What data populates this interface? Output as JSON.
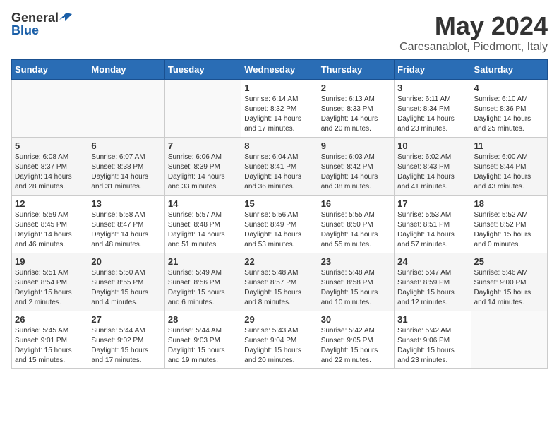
{
  "logo": {
    "general": "General",
    "blue": "Blue"
  },
  "title": "May 2024",
  "subtitle": "Caresanablot, Piedmont, Italy",
  "days_of_week": [
    "Sunday",
    "Monday",
    "Tuesday",
    "Wednesday",
    "Thursday",
    "Friday",
    "Saturday"
  ],
  "weeks": [
    [
      {
        "num": "",
        "info": ""
      },
      {
        "num": "",
        "info": ""
      },
      {
        "num": "",
        "info": ""
      },
      {
        "num": "1",
        "info": "Sunrise: 6:14 AM\nSunset: 8:32 PM\nDaylight: 14 hours\nand 17 minutes."
      },
      {
        "num": "2",
        "info": "Sunrise: 6:13 AM\nSunset: 8:33 PM\nDaylight: 14 hours\nand 20 minutes."
      },
      {
        "num": "3",
        "info": "Sunrise: 6:11 AM\nSunset: 8:34 PM\nDaylight: 14 hours\nand 23 minutes."
      },
      {
        "num": "4",
        "info": "Sunrise: 6:10 AM\nSunset: 8:36 PM\nDaylight: 14 hours\nand 25 minutes."
      }
    ],
    [
      {
        "num": "5",
        "info": "Sunrise: 6:08 AM\nSunset: 8:37 PM\nDaylight: 14 hours\nand 28 minutes."
      },
      {
        "num": "6",
        "info": "Sunrise: 6:07 AM\nSunset: 8:38 PM\nDaylight: 14 hours\nand 31 minutes."
      },
      {
        "num": "7",
        "info": "Sunrise: 6:06 AM\nSunset: 8:39 PM\nDaylight: 14 hours\nand 33 minutes."
      },
      {
        "num": "8",
        "info": "Sunrise: 6:04 AM\nSunset: 8:41 PM\nDaylight: 14 hours\nand 36 minutes."
      },
      {
        "num": "9",
        "info": "Sunrise: 6:03 AM\nSunset: 8:42 PM\nDaylight: 14 hours\nand 38 minutes."
      },
      {
        "num": "10",
        "info": "Sunrise: 6:02 AM\nSunset: 8:43 PM\nDaylight: 14 hours\nand 41 minutes."
      },
      {
        "num": "11",
        "info": "Sunrise: 6:00 AM\nSunset: 8:44 PM\nDaylight: 14 hours\nand 43 minutes."
      }
    ],
    [
      {
        "num": "12",
        "info": "Sunrise: 5:59 AM\nSunset: 8:45 PM\nDaylight: 14 hours\nand 46 minutes."
      },
      {
        "num": "13",
        "info": "Sunrise: 5:58 AM\nSunset: 8:47 PM\nDaylight: 14 hours\nand 48 minutes."
      },
      {
        "num": "14",
        "info": "Sunrise: 5:57 AM\nSunset: 8:48 PM\nDaylight: 14 hours\nand 51 minutes."
      },
      {
        "num": "15",
        "info": "Sunrise: 5:56 AM\nSunset: 8:49 PM\nDaylight: 14 hours\nand 53 minutes."
      },
      {
        "num": "16",
        "info": "Sunrise: 5:55 AM\nSunset: 8:50 PM\nDaylight: 14 hours\nand 55 minutes."
      },
      {
        "num": "17",
        "info": "Sunrise: 5:53 AM\nSunset: 8:51 PM\nDaylight: 14 hours\nand 57 minutes."
      },
      {
        "num": "18",
        "info": "Sunrise: 5:52 AM\nSunset: 8:52 PM\nDaylight: 15 hours\nand 0 minutes."
      }
    ],
    [
      {
        "num": "19",
        "info": "Sunrise: 5:51 AM\nSunset: 8:54 PM\nDaylight: 15 hours\nand 2 minutes."
      },
      {
        "num": "20",
        "info": "Sunrise: 5:50 AM\nSunset: 8:55 PM\nDaylight: 15 hours\nand 4 minutes."
      },
      {
        "num": "21",
        "info": "Sunrise: 5:49 AM\nSunset: 8:56 PM\nDaylight: 15 hours\nand 6 minutes."
      },
      {
        "num": "22",
        "info": "Sunrise: 5:48 AM\nSunset: 8:57 PM\nDaylight: 15 hours\nand 8 minutes."
      },
      {
        "num": "23",
        "info": "Sunrise: 5:48 AM\nSunset: 8:58 PM\nDaylight: 15 hours\nand 10 minutes."
      },
      {
        "num": "24",
        "info": "Sunrise: 5:47 AM\nSunset: 8:59 PM\nDaylight: 15 hours\nand 12 minutes."
      },
      {
        "num": "25",
        "info": "Sunrise: 5:46 AM\nSunset: 9:00 PM\nDaylight: 15 hours\nand 14 minutes."
      }
    ],
    [
      {
        "num": "26",
        "info": "Sunrise: 5:45 AM\nSunset: 9:01 PM\nDaylight: 15 hours\nand 15 minutes."
      },
      {
        "num": "27",
        "info": "Sunrise: 5:44 AM\nSunset: 9:02 PM\nDaylight: 15 hours\nand 17 minutes."
      },
      {
        "num": "28",
        "info": "Sunrise: 5:44 AM\nSunset: 9:03 PM\nDaylight: 15 hours\nand 19 minutes."
      },
      {
        "num": "29",
        "info": "Sunrise: 5:43 AM\nSunset: 9:04 PM\nDaylight: 15 hours\nand 20 minutes."
      },
      {
        "num": "30",
        "info": "Sunrise: 5:42 AM\nSunset: 9:05 PM\nDaylight: 15 hours\nand 22 minutes."
      },
      {
        "num": "31",
        "info": "Sunrise: 5:42 AM\nSunset: 9:06 PM\nDaylight: 15 hours\nand 23 minutes."
      },
      {
        "num": "",
        "info": ""
      }
    ]
  ]
}
